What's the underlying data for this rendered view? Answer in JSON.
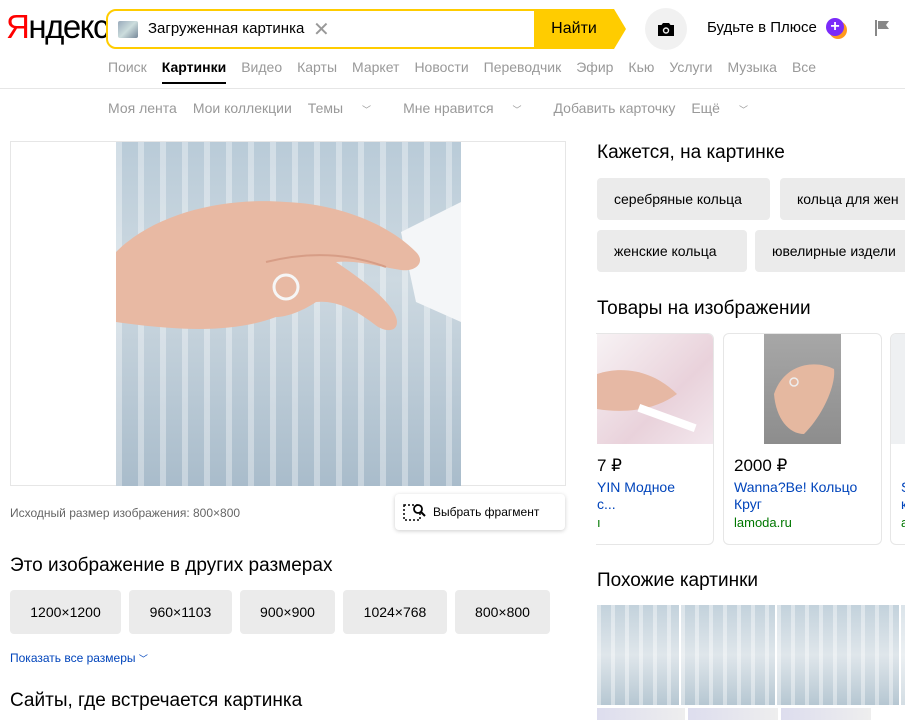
{
  "header": {
    "logo": "Яндекс",
    "search_query": "Загруженная картинка",
    "search_button": "Найти",
    "plus_text": "Будьте в Плюсе",
    "plus_badge": "+"
  },
  "services": [
    "Поиск",
    "Картинки",
    "Видео",
    "Карты",
    "Маркет",
    "Новости",
    "Переводчик",
    "Эфир",
    "Кью",
    "Услуги",
    "Музыка",
    "Все"
  ],
  "active_service": "Картинки",
  "subnav": {
    "feed": "Моя лента",
    "collections": "Мои коллекции",
    "themes": "Темы",
    "likes": "Мне нравится",
    "add_card": "Добавить карточку",
    "more": "Ещё"
  },
  "image": {
    "original_size": "Исходный размер изображения: 800×800",
    "select_fragment": "Выбрать фрагмент"
  },
  "sizes": {
    "heading": "Это изображение в других размерах",
    "items": [
      "1200×1200",
      "960×1103",
      "900×900",
      "1024×768",
      "800×800"
    ],
    "show_all": "Показать все размеры"
  },
  "sites": {
    "heading": "Сайты, где встречается картинка"
  },
  "tags": {
    "heading": "Кажется, на картинке",
    "items": [
      "серебряные кольца",
      "кольца для жен",
      "женские кольца",
      "ювелирные издели"
    ]
  },
  "products": {
    "heading": "Товары на изображении",
    "items": [
      {
        "price": "7 ₽",
        "title": "YIN Модное\nс...",
        "shop": "ı"
      },
      {
        "price": "2000 ₽",
        "title": "Wanna?Be! Кольцо\nКруг",
        "shop": "lamoda.ru"
      },
      {
        "price": "",
        "title": "S\nк",
        "shop": "a"
      }
    ]
  },
  "similar": {
    "heading": "Похожие картинки"
  },
  "colors": {
    "search_accent": "#ffcc00",
    "link": "#0044bb",
    "shop": "#007700",
    "logo_red": "#ff0000"
  }
}
